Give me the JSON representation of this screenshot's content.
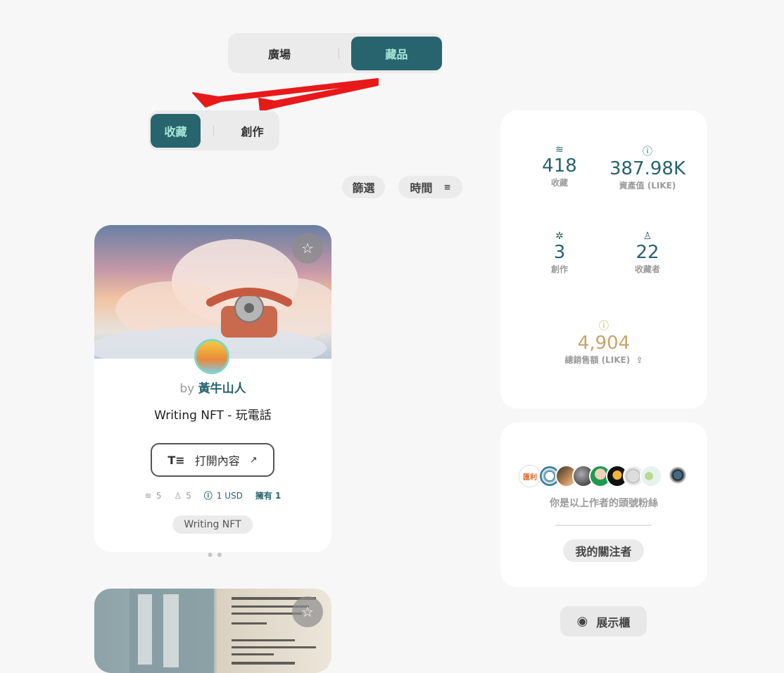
{
  "top_tabs": {
    "plaza": "廣場",
    "collection": "藏品"
  },
  "sub_tabs": {
    "collected": "收藏",
    "created": "創作"
  },
  "filters": {
    "filter_label": "篩選",
    "sort_label": "時間"
  },
  "nft_card": {
    "by_prefix": "by",
    "author": "黃牛山人",
    "title": "Writing NFT - 玩電話",
    "open_button": "打開內容",
    "stats": {
      "collections": "5",
      "collectors": "5",
      "price": "1 USD",
      "owned": "擁有 1"
    },
    "tag": "Writing NFT"
  },
  "stats_panel": {
    "collected": {
      "value": "418",
      "label": "收藏"
    },
    "asset_value": {
      "value": "387.98K",
      "label": "資產值 (LIKE)"
    },
    "created": {
      "value": "3",
      "label": "創作"
    },
    "collectors": {
      "value": "22",
      "label": "收藏者"
    },
    "total_sales": {
      "value": "4,904",
      "label": "總銷售額 (LIKE)"
    }
  },
  "followers_panel": {
    "avatar_badge_text": "匯利",
    "caption": "你是以上作者的頭號粉絲",
    "button": "我的關注者"
  },
  "showcase_button": "展示櫃",
  "colors": {
    "accent": "#28646e",
    "accent_text": "#a8e6d8",
    "sales": "#c9a36b",
    "annotation": "#e8191a"
  }
}
